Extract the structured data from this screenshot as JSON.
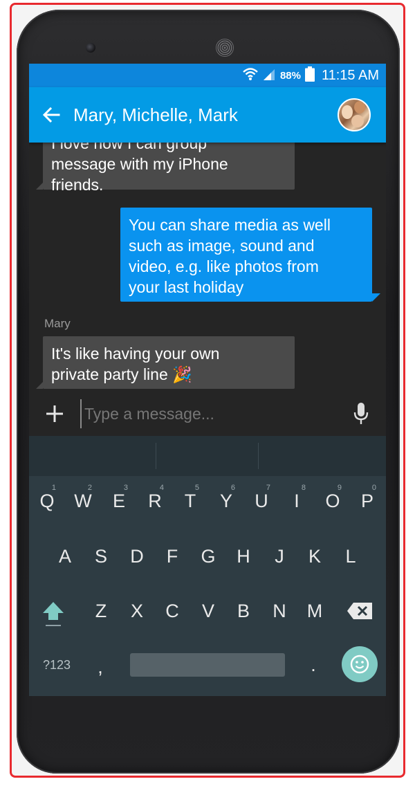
{
  "status_bar": {
    "battery_percent": "88%",
    "time": "11:15 AM",
    "icons": [
      "wifi-icon",
      "signal-icon",
      "battery-icon"
    ]
  },
  "app_bar": {
    "title": "Mary, Michelle, Mark",
    "back_icon": "arrow-left-icon",
    "avatar": "group-avatar"
  },
  "messages": [
    {
      "direction": "incoming",
      "sender": "",
      "partial_line": "I love how I can group",
      "lines": [
        "message with my iPhone",
        "friends."
      ]
    },
    {
      "direction": "outgoing",
      "sender": "",
      "lines": [
        "You can share media as well",
        "such as image, sound and",
        "video, e.g. like photos from",
        "your last holiday"
      ]
    },
    {
      "direction": "incoming",
      "sender": "Mary",
      "lines": [
        "It's like having your own",
        "private party line 🎉"
      ]
    }
  ],
  "composer": {
    "placeholder": "Type a message...",
    "value": ""
  },
  "keyboard": {
    "row1": [
      {
        "label": "Q",
        "hint": "1"
      },
      {
        "label": "W",
        "hint": "2"
      },
      {
        "label": "E",
        "hint": "3"
      },
      {
        "label": "R",
        "hint": "4"
      },
      {
        "label": "T",
        "hint": "5"
      },
      {
        "label": "Y",
        "hint": "6"
      },
      {
        "label": "U",
        "hint": "7"
      },
      {
        "label": "I",
        "hint": "8"
      },
      {
        "label": "O",
        "hint": "9"
      },
      {
        "label": "P",
        "hint": "0"
      }
    ],
    "row2": [
      "A",
      "S",
      "D",
      "F",
      "G",
      "H",
      "J",
      "K",
      "L"
    ],
    "row3": [
      "Z",
      "X",
      "C",
      "V",
      "B",
      "N",
      "M"
    ],
    "symbols_label": "?123",
    "comma_label": ",",
    "period_label": ".",
    "accent_color": "#80cbc4"
  },
  "colors": {
    "status_bar": "#0d86dc",
    "app_bar": "#039be5",
    "outgoing_bubble": "#0a93ef",
    "incoming_bubble": "#4a4a4a",
    "keyboard": "#2e3c43"
  }
}
